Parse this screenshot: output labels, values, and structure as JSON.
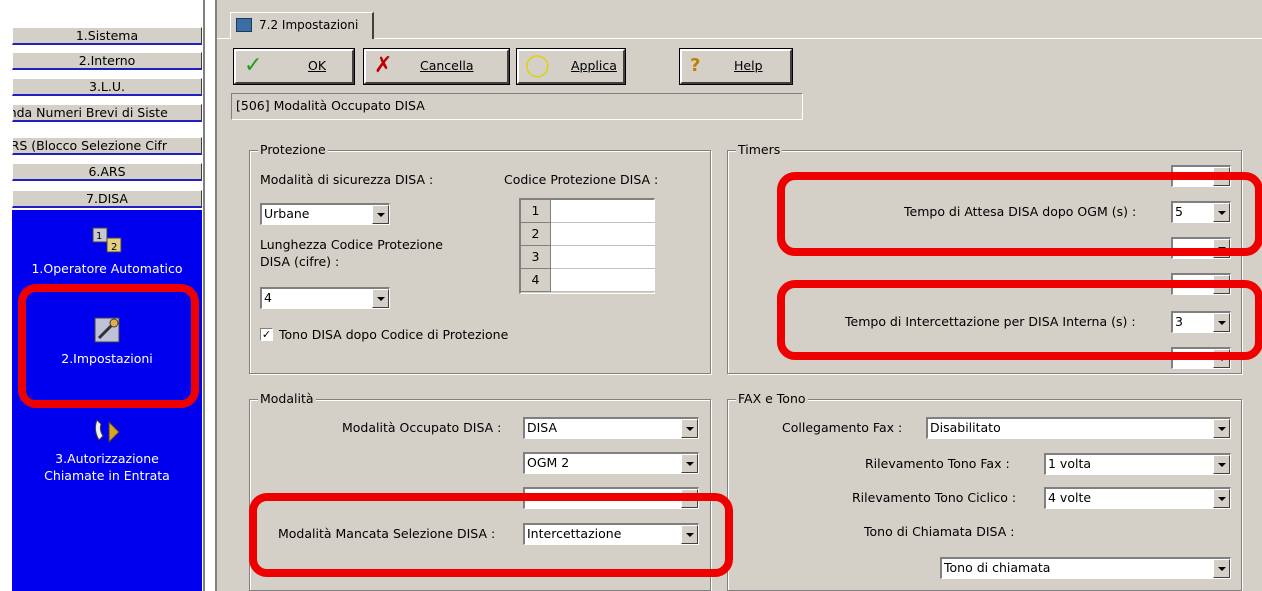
{
  "nav": {
    "items": [
      "1.Sistema",
      "2.Interno",
      "3.L.U.",
      "enda Numeri Brevi di Siste",
      "TRS (Blocco Selezione Cifr",
      "6.ARS",
      "7.DISA"
    ],
    "sub_items": [
      {
        "label": "1.Operatore Automatico",
        "icon": "auto-attendant-icon"
      },
      {
        "label": "2.Impostazioni",
        "icon": "settings-icon"
      },
      {
        "label": "3.Autorizzazione Chiamate in Entrata",
        "label_line1": "3.Autorizzazione",
        "label_line2": "Chiamate in Entrata",
        "icon": "incoming-call-icon"
      }
    ]
  },
  "tab": {
    "label": "7.2 Impostazioni"
  },
  "toolbar": {
    "ok": "OK",
    "cancel": "Cancella",
    "apply": "Applica",
    "help": "Help"
  },
  "description": "[506] Modalità Occupato DISA",
  "protezione": {
    "title": "Protezione",
    "security_mode_label": "Modalità di sicurezza DISA :",
    "security_mode_value": "Urbane",
    "code_label": "Codice Protezione DISA :",
    "code_rows": [
      "1",
      "2",
      "3",
      "4"
    ],
    "length_label_line1": "Lunghezza Codice Protezione",
    "length_label_line2": "DISA (cifre) :",
    "length_value": "4",
    "tone_checkbox_label": "Tono DISA dopo Codice di Protezione",
    "tone_checked": true
  },
  "timers": {
    "title": "Timers",
    "wait_label": "Tempo di Attesa DISA dopo OGM (s) :",
    "wait_value": "5",
    "intercept_label": "Tempo di Intercettazione per DISA Interna (s) :",
    "intercept_value": "3"
  },
  "modalita": {
    "title": "Modalità",
    "busy_label": "Modalità Occupato DISA :",
    "busy_value": "DISA",
    "ogm_value": "OGM 2",
    "nodial_label": "Modalità Mancata Selezione DISA :",
    "nodial_value": "Intercettazione"
  },
  "fax": {
    "title": "FAX e Tono",
    "fax_label": "Collegamento Fax :",
    "fax_value": "Disabilitato",
    "fax_tone_label": "Rilevamento Tono Fax :",
    "fax_tone_value": "1 volta",
    "cyclic_label": "Rilevamento Tono Ciclico :",
    "cyclic_value": "4 volte",
    "ring_label": "Tono di Chiamata DISA :",
    "ring_value": "Tono di chiamata"
  },
  "colors": {
    "highlight": "#ee0000",
    "nav_blue": "#0000ee",
    "panel_gray": "#d4d0c8"
  }
}
